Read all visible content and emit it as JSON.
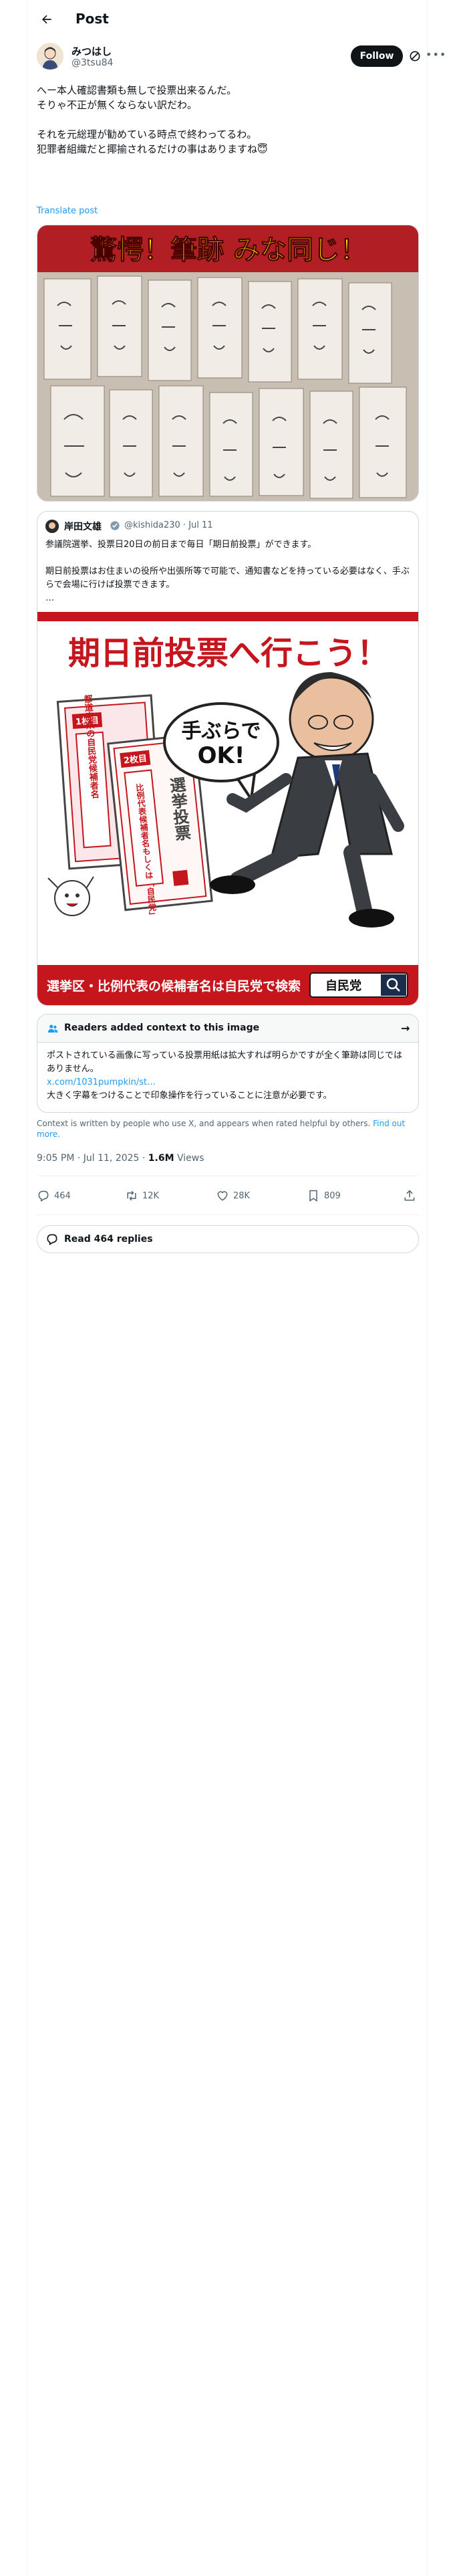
{
  "header": {
    "title": "Post"
  },
  "author": {
    "name": "みつはし",
    "handle": "@3tsu84",
    "follow_label": "Follow"
  },
  "post": {
    "text": "へー本人確認書類も無しで投票出来るんだ。\nそりゃ不正が無くならない訳だわ。\n\nそれを元総理が勧めている時点で終わってるわ。\n犯罪者組織だと揶揄されるだけの事はありますね😇",
    "translate_label": "Translate post",
    "image_banner": "驚愕！筆跡 みな同じ！"
  },
  "quote": {
    "name": "岸田文雄",
    "handle": "@kishida230",
    "date": "Jul 11",
    "text": "参議院選挙、投票日20日の前日まで毎日「期日前投票」ができます。\n\n期日前投票はお住まいの役所や出張所等で可能で、通知書などを持っている必要はなく、手ぶらで会場に行けば投票できます。\n…",
    "ad_title": "期日前投票へ行こう！",
    "ad_bubble": "手ぶらで\nOK!",
    "ad_card1_badge": "1枚目",
    "ad_card1_text": "都道府県の自民党候補者名",
    "ad_card2_badge": "2枚目",
    "ad_card2_text": "比例代表候補者名もしくは「自民党」",
    "ad_card_head": "選挙投票",
    "ad_footer": "選挙区・比例代表の候補者名は自民党で検索",
    "ad_search": "自民党"
  },
  "note": {
    "title": "Readers added context to this image",
    "text": "ポストされている画像に写っている投票用紙は拡大すれば明らかですが全く筆跡は同じではありません。",
    "link": "x.com/1031pumpkin/st…",
    "text2": "大きく字幕をつけることで印象操作を行っていることに注意が必要です。"
  },
  "context": {
    "text": "Context is written by people who use X, and appears when rated helpful by others.",
    "link": "Find out more."
  },
  "meta": {
    "time": "9:05 PM · Jul 11, 2025 · ",
    "views_count": "1.6M",
    "views_label": " Views"
  },
  "actions": {
    "replies": "464",
    "reposts": "12K",
    "likes": "28K",
    "bookmarks": "809"
  },
  "read_replies": "Read 464 replies",
  "colors": {
    "accent": "#1d9bf0",
    "ad_red": "#c4161c",
    "banner_yellow": "#ffe600"
  }
}
